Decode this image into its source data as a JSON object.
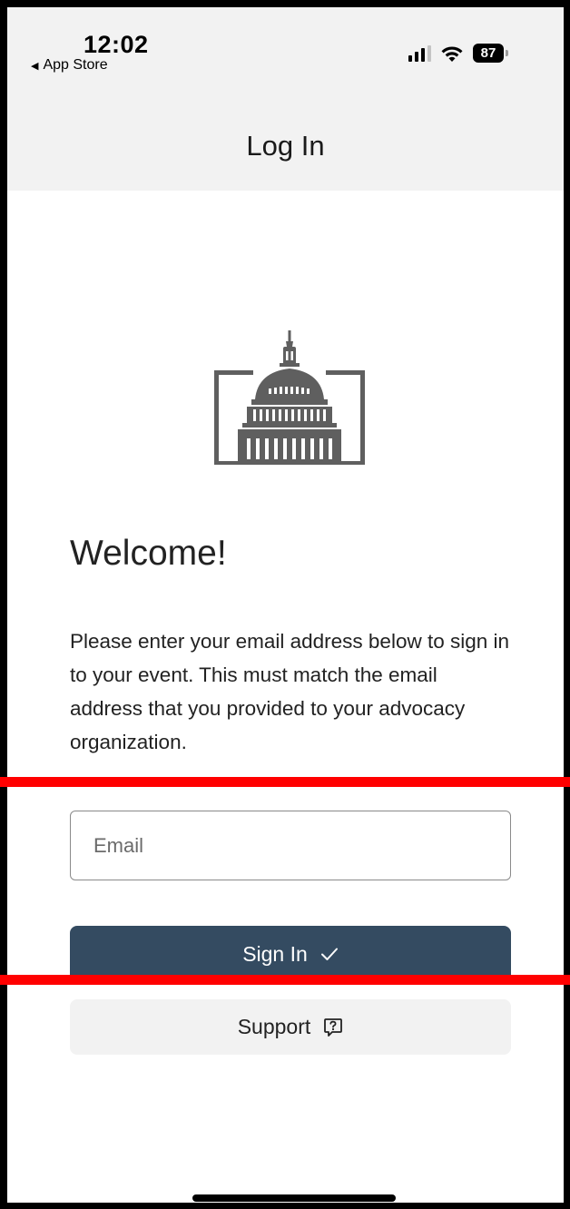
{
  "status_bar": {
    "time": "12:02",
    "back_app_label": "App Store",
    "battery_level": "87",
    "signal_bars": 3,
    "wifi": true
  },
  "nav": {
    "title": "Log In"
  },
  "logo": {
    "icon": "capitol-building-icon",
    "color": "#5f5f5f"
  },
  "welcome": {
    "heading": "Welcome!",
    "description": "Please enter your email address below to sign in to your event. This must match the email address that you provided to your advocacy organization."
  },
  "form": {
    "email_placeholder": "Email",
    "email_value": ""
  },
  "buttons": {
    "sign_in_label": "Sign In",
    "sign_in_icon": "checkmark-icon",
    "support_label": "Support",
    "support_icon": "help-message-icon"
  },
  "colors": {
    "primary_button": "#344b61",
    "secondary_button": "#f2f2f2",
    "header_background": "#f2f2f2",
    "annotation_lines": "#ff0000"
  }
}
